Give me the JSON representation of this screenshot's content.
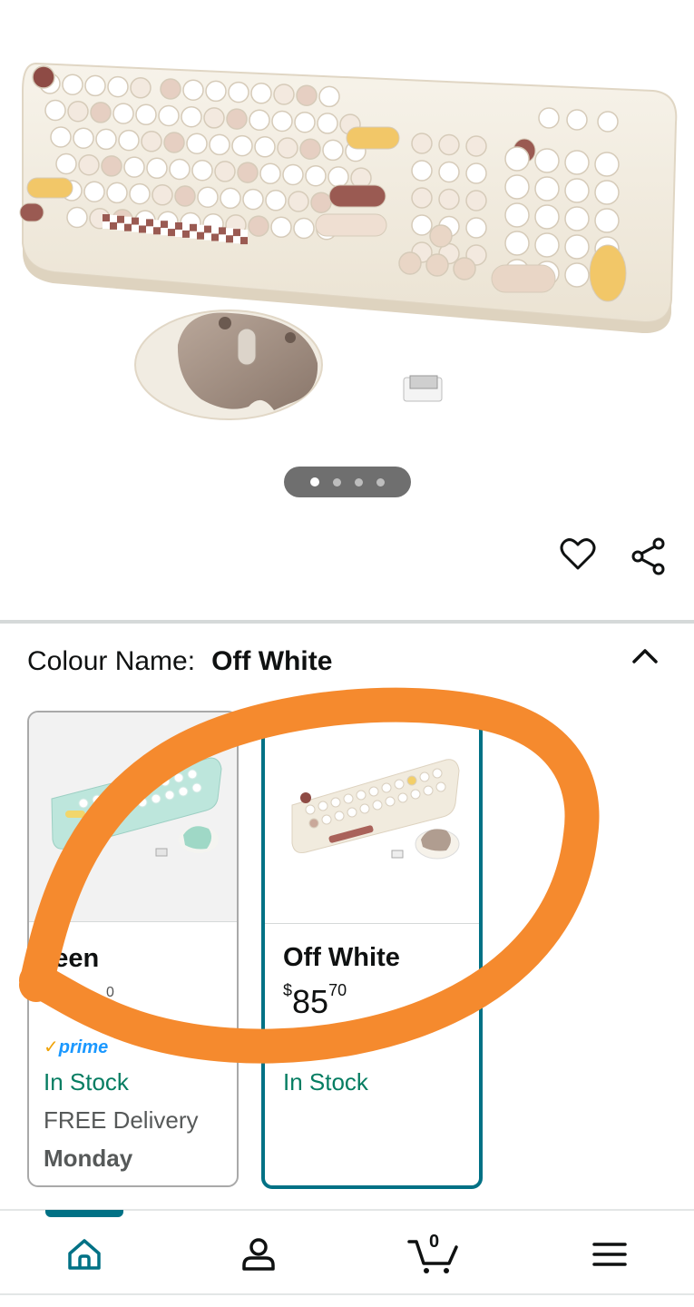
{
  "hero": {
    "image_alt": "keyboard-and-mouse-product-photo",
    "carousel_total": 4,
    "carousel_active": 1
  },
  "actions": {
    "wishlist_icon": "heart-icon",
    "share_icon": "share-icon"
  },
  "variation": {
    "label": "Colour Name:",
    "selected": "Off White",
    "collapse_icon": "chevron-up-icon",
    "options": [
      {
        "name": "Green",
        "name_visible": "reen",
        "price_partial": "0",
        "prime": "prime",
        "stock": "In Stock",
        "delivery": "FREE Delivery",
        "delivery_day": "Monday",
        "selected": false
      },
      {
        "name": "Off White",
        "price_symbol": "$",
        "price_whole": "85",
        "price_fraction": "70",
        "stock": "In Stock",
        "selected": true
      }
    ]
  },
  "annotation": {
    "color": "#f58a2e",
    "shape": "hand-drawn-circle"
  },
  "nav": {
    "items": [
      {
        "name": "home",
        "icon": "home-icon",
        "active": true
      },
      {
        "name": "account",
        "icon": "person-icon",
        "active": false
      },
      {
        "name": "cart",
        "icon": "cart-icon",
        "count": "0",
        "active": false
      },
      {
        "name": "menu",
        "icon": "hamburger-icon",
        "active": false
      }
    ]
  },
  "colors": {
    "accent": "#007185",
    "stock_green": "#067d62",
    "prime_blue": "#1a98ff"
  }
}
